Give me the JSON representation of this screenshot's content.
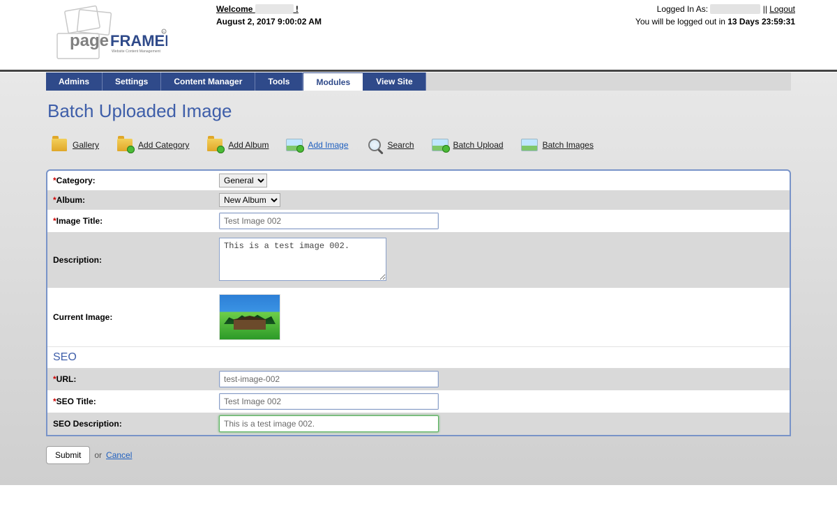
{
  "header": {
    "welcome_prefix": "Welcome ",
    "welcome_suffix": " !",
    "date": "August 2, 2017 9:00:02 AM",
    "logged_in_prefix": "Logged In As: ",
    "logout_sep": " || ",
    "logout_label": "Logout",
    "timeout_prefix": "You will be logged out in ",
    "timeout_value": "13 Days 23:59:31"
  },
  "logo": {
    "brand_left": "page",
    "brand_right": "FRAMER",
    "tagline": "Website Content Management"
  },
  "nav": {
    "items": [
      "Admins",
      "Settings",
      "Content Manager",
      "Tools",
      "Modules",
      "View Site"
    ],
    "active_index": 4
  },
  "page_title": "Batch Uploaded Image",
  "toolbar": {
    "items": [
      {
        "label": "Gallery"
      },
      {
        "label": "Add Category"
      },
      {
        "label": "Add Album"
      },
      {
        "label": "Add Image"
      },
      {
        "label": "Search"
      },
      {
        "label": "Batch Upload"
      },
      {
        "label": "Batch Images"
      }
    ],
    "active_index": 3
  },
  "form": {
    "category_label": "Category:",
    "category_value": "General",
    "album_label": "Album:",
    "album_value": "New Album",
    "image_title_label": "Image Title:",
    "image_title_value": "Test Image 002",
    "description_label": "Description:",
    "description_value": "This is a test image 002.",
    "current_image_label": "Current Image:",
    "seo_heading": "SEO",
    "url_label": "URL:",
    "url_value": "test-image-002",
    "seo_title_label": "SEO Title:",
    "seo_title_value": "Test Image 002",
    "seo_desc_label": "SEO Description:",
    "seo_desc_value": "This is a test image 002."
  },
  "actions": {
    "submit": "Submit",
    "or": " or ",
    "cancel": "Cancel"
  }
}
